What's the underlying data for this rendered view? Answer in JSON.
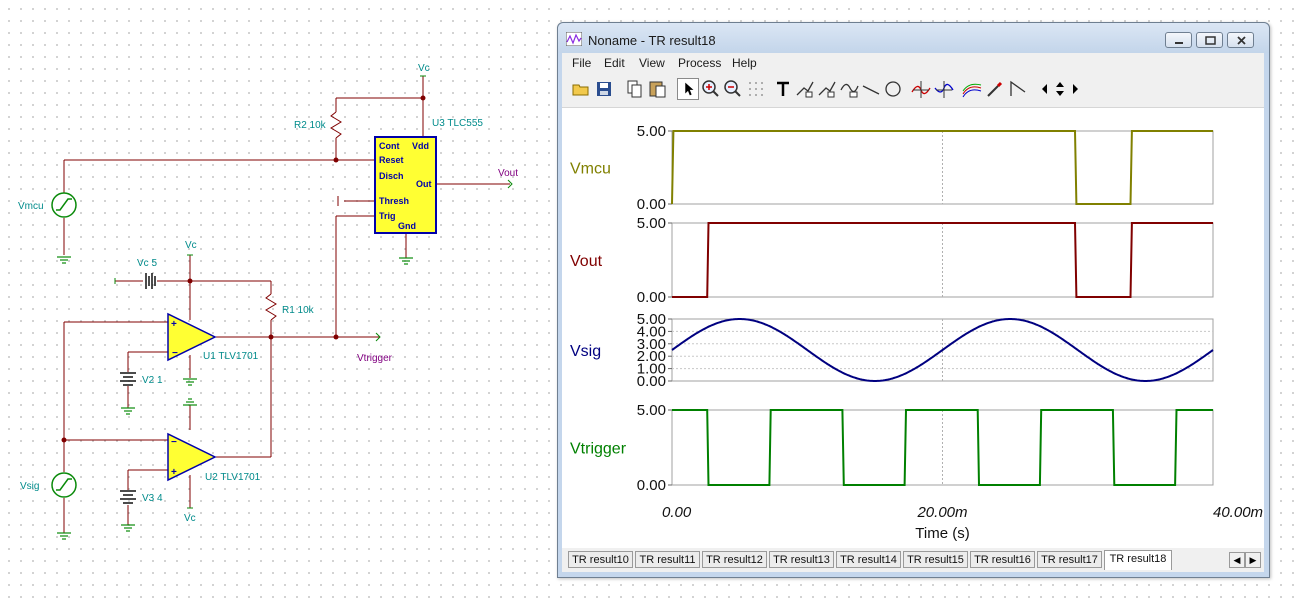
{
  "schematic": {
    "labels": {
      "vc_top": "Vc",
      "r2": "R2 10k",
      "u3": "U3 TLC555",
      "pin_cont": "Cont",
      "pin_vdd": "Vdd",
      "pin_reset": "Reset",
      "pin_disch": "Disch",
      "pin_out": "Out",
      "pin_thresh": "Thresh",
      "pin_trig": "Trig",
      "pin_gnd": "Gnd",
      "vout": "Vout",
      "vmcu": "Vmcu",
      "vc5": "Vc 5",
      "vc_mid": "Vc",
      "r1": "R1 10k",
      "u1": "U1 TLV1701",
      "vtrigger": "Vtrigger",
      "v2": "V2 1",
      "vsig": "Vsig",
      "u2": "U2 TLV1701",
      "v3": "V3 4",
      "vc_bottom": "Vc"
    }
  },
  "window": {
    "title": "Noname - TR result18",
    "menu": [
      "File",
      "Edit",
      "View",
      "Process",
      "Help"
    ],
    "toolbar_icons": [
      "open-icon",
      "save-icon",
      "copy-icon",
      "paste-icon",
      "pointer-icon",
      "zoom-in-icon",
      "zoom-out-icon",
      "grid-icon",
      "text-icon",
      "label-icon",
      "label2-icon",
      "annotation-icon",
      "line-icon",
      "circle-icon",
      "cursor-a-icon",
      "cursor-b-icon",
      "curve-icon",
      "probe-icon",
      "slope-icon",
      "scroll-arrows-icon"
    ]
  },
  "chart_data": [
    {
      "type": "line",
      "name": "Vmcu",
      "color": "#808000",
      "ylim": [
        0,
        5
      ],
      "yticks": [
        "5.00",
        "0.00"
      ],
      "x": [
        0,
        0.0001,
        0.0298,
        0.0299,
        0.0339,
        0.034,
        0.04
      ],
      "y": [
        0,
        5,
        5,
        0,
        0,
        5,
        5
      ]
    },
    {
      "type": "line",
      "name": "Vout",
      "color": "#800000",
      "ylim": [
        0,
        5
      ],
      "yticks": [
        "5.00",
        "0.00"
      ],
      "x": [
        0,
        0.0026,
        0.0027,
        0.0298,
        0.0299,
        0.0339,
        0.034,
        0.04
      ],
      "y": [
        0,
        0,
        5,
        5,
        0,
        0,
        5,
        5
      ]
    },
    {
      "type": "line",
      "name": "Vsig",
      "color": "#000080",
      "ylim": [
        0.5,
        4.5
      ],
      "yticks": [
        "5.00",
        "4.00",
        "3.00",
        "2.00",
        "1.00",
        "0.00"
      ],
      "function": "sine",
      "offset": 2.5,
      "amplitude": 2.0,
      "period": 0.02,
      "phase_deg": 0
    },
    {
      "type": "line",
      "name": "Vtrigger",
      "color": "#008000",
      "ylim": [
        0,
        5
      ],
      "yticks": [
        "5.00",
        "0.00"
      ],
      "x": [
        0,
        0.0026,
        0.0027,
        0.0072,
        0.0073,
        0.0126,
        0.0127,
        0.0172,
        0.0173,
        0.0226,
        0.0227,
        0.0272,
        0.0273,
        0.0326,
        0.0327,
        0.0372,
        0.0373,
        0.04
      ],
      "y": [
        5,
        5,
        0,
        0,
        5,
        5,
        0,
        0,
        5,
        5,
        0,
        0,
        5,
        5,
        0,
        0,
        5,
        5
      ]
    }
  ],
  "xaxis": {
    "label": "Time (s)",
    "ticks": [
      "0.00",
      "20.00m",
      "40.00m"
    ],
    "range": [
      0,
      0.04
    ]
  },
  "tabs": [
    "TR result10",
    "TR result11",
    "TR result12",
    "TR result13",
    "TR result14",
    "TR result15",
    "TR result16",
    "TR result17",
    "TR result18"
  ],
  "active_tab": "TR result18"
}
